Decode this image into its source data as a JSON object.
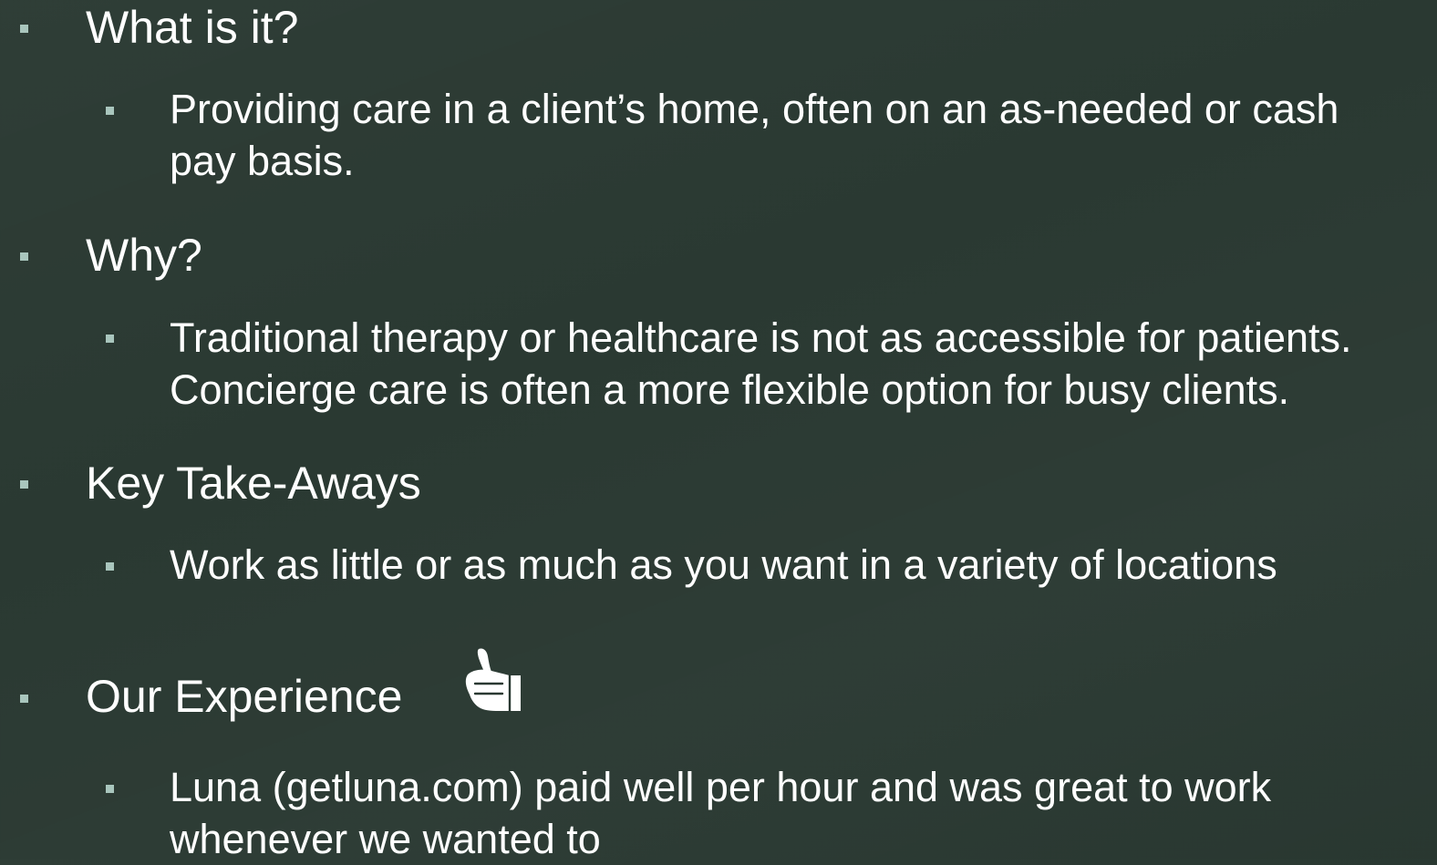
{
  "slide": {
    "colors": {
      "background": "#2a3932",
      "bullet": "#a9c6bd",
      "text": "#ffffff"
    },
    "items": [
      {
        "heading": "What is it?",
        "detail_lines": [
          "Providing care in a client’s home, often on an as-needed or cash",
          "pay basis."
        ]
      },
      {
        "heading": "Why?",
        "detail_lines": [
          "Traditional therapy or healthcare is not as accessible for patients.",
          "Concierge care is often a more flexible option for busy clients."
        ]
      },
      {
        "heading": "Key Take-Aways",
        "detail_lines": [
          "Work as little or as much as you want in a variety of locations"
        ]
      },
      {
        "heading": "Our Experience",
        "icon": "thumbs-up-icon",
        "detail_lines": [
          "Luna (getluna.com) paid well per hour and was great to work",
          "whenever we wanted to"
        ]
      }
    ]
  }
}
